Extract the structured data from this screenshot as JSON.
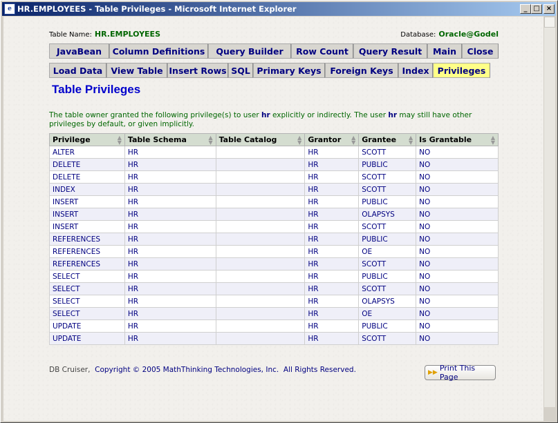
{
  "window": {
    "title": "HR.EMPLOYEES - Table Privileges - Microsoft Internet Explorer",
    "min": "_",
    "max": "□",
    "close": "×"
  },
  "header": {
    "table_name_label": "Table Name:",
    "table_name": "HR.EMPLOYEES",
    "database_label": "Database:",
    "database": "Oracle@Godel"
  },
  "tabs_row1": [
    {
      "label": "JavaBean"
    },
    {
      "label": "Column Definitions"
    },
    {
      "label": "Query Builder"
    },
    {
      "label": "Row Count"
    },
    {
      "label": "Query Result"
    },
    {
      "label": "Main"
    },
    {
      "label": "Close"
    }
  ],
  "tabs_row2": [
    {
      "label": "Load Data"
    },
    {
      "label": "View Table"
    },
    {
      "label": "Insert Rows"
    },
    {
      "label": "SQL"
    },
    {
      "label": "Primary Keys"
    },
    {
      "label": "Foreign Keys"
    },
    {
      "label": "Index"
    },
    {
      "label": "Privileges"
    }
  ],
  "page_title": "Table Privileges",
  "description": {
    "part1": "The table owner granted the following privilege(s) to user ",
    "user1": "hr",
    "part2": " explicitly or indirectly. The user ",
    "user2": "hr",
    "part3": " may still have other privileges by default, or given implicitly."
  },
  "table": {
    "columns": [
      "Privilege",
      "Table Schema",
      "Table Catalog",
      "Grantor",
      "Grantee",
      "Is Grantable"
    ],
    "rows": [
      [
        "ALTER",
        "HR",
        "",
        "HR",
        "SCOTT",
        "NO"
      ],
      [
        "DELETE",
        "HR",
        "",
        "HR",
        "PUBLIC",
        "NO"
      ],
      [
        "DELETE",
        "HR",
        "",
        "HR",
        "SCOTT",
        "NO"
      ],
      [
        "INDEX",
        "HR",
        "",
        "HR",
        "SCOTT",
        "NO"
      ],
      [
        "INSERT",
        "HR",
        "",
        "HR",
        "PUBLIC",
        "NO"
      ],
      [
        "INSERT",
        "HR",
        "",
        "HR",
        "OLAPSYS",
        "NO"
      ],
      [
        "INSERT",
        "HR",
        "",
        "HR",
        "SCOTT",
        "NO"
      ],
      [
        "REFERENCES",
        "HR",
        "",
        "HR",
        "PUBLIC",
        "NO"
      ],
      [
        "REFERENCES",
        "HR",
        "",
        "HR",
        "OE",
        "NO"
      ],
      [
        "REFERENCES",
        "HR",
        "",
        "HR",
        "SCOTT",
        "NO"
      ],
      [
        "SELECT",
        "HR",
        "",
        "HR",
        "PUBLIC",
        "NO"
      ],
      [
        "SELECT",
        "HR",
        "",
        "HR",
        "SCOTT",
        "NO"
      ],
      [
        "SELECT",
        "HR",
        "",
        "HR",
        "OLAPSYS",
        "NO"
      ],
      [
        "SELECT",
        "HR",
        "",
        "HR",
        "OE",
        "NO"
      ],
      [
        "UPDATE",
        "HR",
        "",
        "HR",
        "PUBLIC",
        "NO"
      ],
      [
        "UPDATE",
        "HR",
        "",
        "HR",
        "SCOTT",
        "NO"
      ]
    ]
  },
  "footer": {
    "app": "DB Cruiser,",
    "copyright": "Copyright © 2005 MathThinking Technologies, Inc.",
    "rights": "All Rights Reserved."
  },
  "print_button": "Print This Page"
}
